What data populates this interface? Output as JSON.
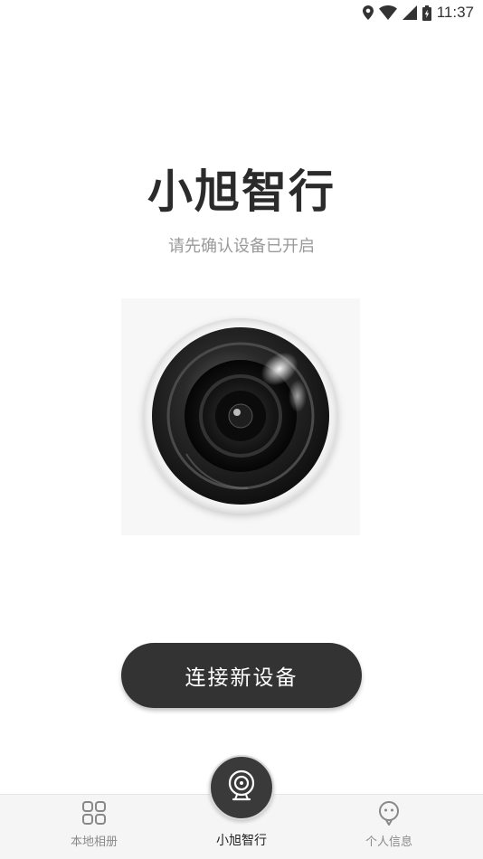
{
  "status_bar": {
    "time": "11:37",
    "icons": [
      "location-icon",
      "wifi-icon",
      "signal-icon",
      "battery-icon"
    ]
  },
  "main": {
    "title": "小旭智行",
    "subtitle": "请先确认设备已开启",
    "illustration": "camera-lens-icon",
    "connect_button_label": "连接新设备"
  },
  "bottom_nav": {
    "items": [
      {
        "label": "本地相册",
        "icon": "grid-icon",
        "active": false
      },
      {
        "label": "小旭智行",
        "icon": "webcam-icon",
        "active": true
      },
      {
        "label": "个人信息",
        "icon": "profile-icon",
        "active": false
      }
    ]
  },
  "colors": {
    "primary_dark": "#333333",
    "title_text": "#2b2b2b",
    "subtitle_text": "#9a9a9a",
    "nav_background": "#f5f5f5"
  }
}
